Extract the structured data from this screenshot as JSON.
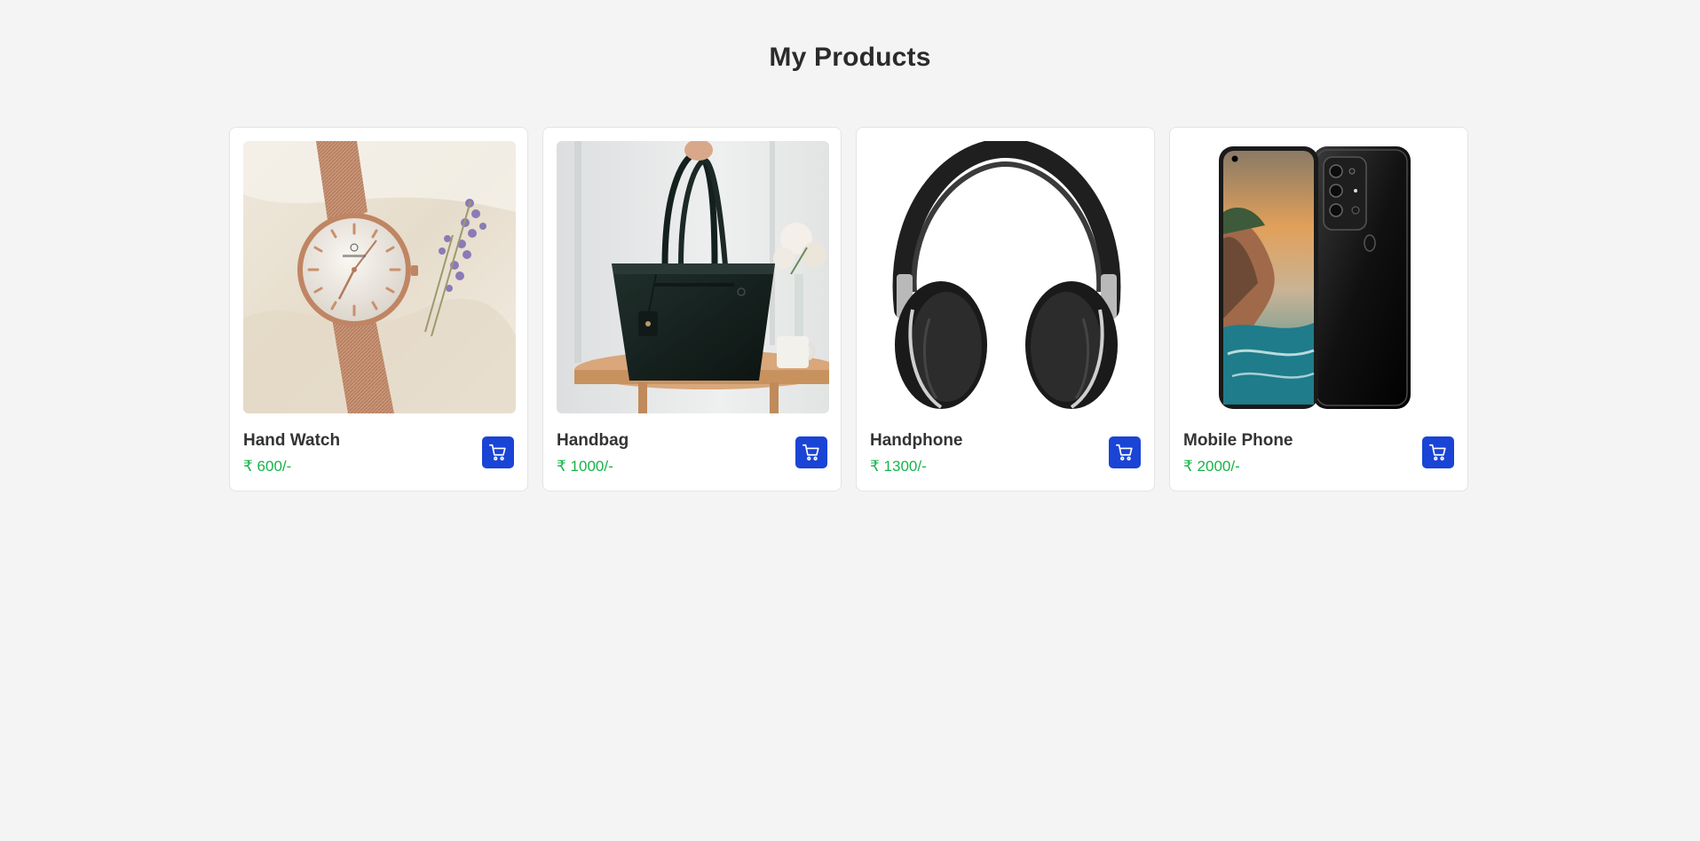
{
  "page": {
    "title": "My Products"
  },
  "colors": {
    "accent": "#1a44d6",
    "price": "#16b44a"
  },
  "currency_symbol": "₹",
  "products": [
    {
      "name": "Hand Watch",
      "price": "₹ 600/-",
      "image_icon": "watch-image"
    },
    {
      "name": "Handbag",
      "price": "₹ 1000/-",
      "image_icon": "handbag-image"
    },
    {
      "name": "Handphone",
      "price": "₹ 1300/-",
      "image_icon": "headphones-image"
    },
    {
      "name": "Mobile Phone",
      "price": "₹ 2000/-",
      "image_icon": "mobile-phone-image"
    }
  ],
  "cart_button": {
    "icon": "cart-icon"
  }
}
